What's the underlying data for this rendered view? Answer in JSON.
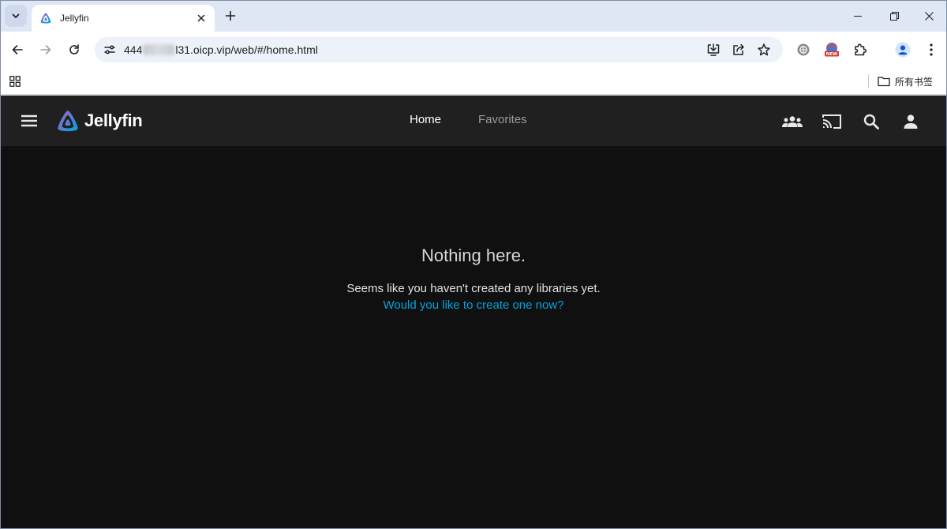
{
  "browser": {
    "tab": {
      "title": "Jellyfin"
    },
    "address": {
      "url_prefix": "444",
      "url_suffix": "l31.oicp.vip/web/#/home.html"
    },
    "bookmarks": {
      "folder_label": "所有书签"
    },
    "extension_badge": "NEW"
  },
  "app": {
    "logo_text": "Jellyfin",
    "nav": [
      {
        "label": "Home",
        "active": true
      },
      {
        "label": "Favorites",
        "active": false
      }
    ],
    "empty_state": {
      "title": "Nothing here.",
      "message": "Seems like you haven't created any libraries yet.",
      "link": "Would you like to create one now?"
    }
  },
  "colors": {
    "accent_link": "#00a4dc",
    "app_header": "#202020",
    "app_background": "#101010",
    "browser_frame": "#dfe7f5"
  },
  "icons": [
    "tab-search-icon",
    "jellyfin-favicon",
    "close-icon",
    "plus-icon",
    "minimize-icon",
    "restore-icon",
    "back-icon",
    "forward-icon",
    "reload-icon",
    "tune-icon",
    "install-app-icon",
    "share-icon",
    "star-icon",
    "translate-icon",
    "extension-new-icon",
    "puzzle-icon",
    "profile-icon",
    "more-vert-icon",
    "apps-grid-icon",
    "folder-icon",
    "hamburger-menu-icon",
    "jellyfin-logo-icon",
    "group-icon",
    "cast-icon",
    "search-icon",
    "user-icon"
  ]
}
